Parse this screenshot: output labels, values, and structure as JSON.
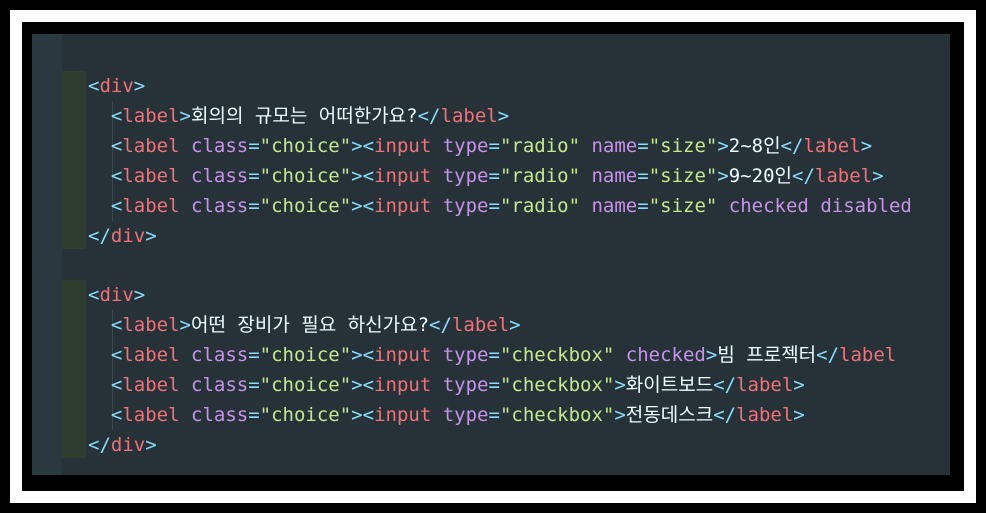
{
  "colors": {
    "background": "#263238",
    "tag": "#f07178",
    "bracket": "#89ddff",
    "attribute": "#c792ea",
    "string": "#c3e88d",
    "text": "#eeffff"
  },
  "lines": [
    {
      "tokens": [
        [
          "brk",
          "<"
        ],
        [
          "tag",
          "div"
        ],
        [
          "brk",
          ">"
        ]
      ]
    },
    {
      "tokens": [
        [
          "txt",
          "  "
        ],
        [
          "brk",
          "<"
        ],
        [
          "tag",
          "label"
        ],
        [
          "brk",
          ">"
        ],
        [
          "txt",
          "회의의 규모는 어떠한가요?"
        ],
        [
          "brk",
          "</"
        ],
        [
          "tag",
          "label"
        ],
        [
          "brk",
          ">"
        ]
      ]
    },
    {
      "tokens": [
        [
          "txt",
          "  "
        ],
        [
          "brk",
          "<"
        ],
        [
          "tag",
          "label"
        ],
        [
          "txt",
          " "
        ],
        [
          "attr",
          "class"
        ],
        [
          "brk",
          "="
        ],
        [
          "str",
          "\"choice\""
        ],
        [
          "brk",
          "><"
        ],
        [
          "tag",
          "input"
        ],
        [
          "txt",
          " "
        ],
        [
          "attr",
          "type"
        ],
        [
          "brk",
          "="
        ],
        [
          "str",
          "\"radio\""
        ],
        [
          "txt",
          " "
        ],
        [
          "attr",
          "name"
        ],
        [
          "brk",
          "="
        ],
        [
          "str",
          "\"size\""
        ],
        [
          "brk",
          ">"
        ],
        [
          "txt",
          "2~8인"
        ],
        [
          "brk",
          "</"
        ],
        [
          "tag",
          "label"
        ],
        [
          "brk",
          ">"
        ]
      ]
    },
    {
      "tokens": [
        [
          "txt",
          "  "
        ],
        [
          "brk",
          "<"
        ],
        [
          "tag",
          "label"
        ],
        [
          "txt",
          " "
        ],
        [
          "attr",
          "class"
        ],
        [
          "brk",
          "="
        ],
        [
          "str",
          "\"choice\""
        ],
        [
          "brk",
          "><"
        ],
        [
          "tag",
          "input"
        ],
        [
          "txt",
          " "
        ],
        [
          "attr",
          "type"
        ],
        [
          "brk",
          "="
        ],
        [
          "str",
          "\"radio\""
        ],
        [
          "txt",
          " "
        ],
        [
          "attr",
          "name"
        ],
        [
          "brk",
          "="
        ],
        [
          "str",
          "\"size\""
        ],
        [
          "brk",
          ">"
        ],
        [
          "txt",
          "9~20인"
        ],
        [
          "brk",
          "</"
        ],
        [
          "tag",
          "label"
        ],
        [
          "brk",
          ">"
        ]
      ]
    },
    {
      "tokens": [
        [
          "txt",
          "  "
        ],
        [
          "brk",
          "<"
        ],
        [
          "tag",
          "label"
        ],
        [
          "txt",
          " "
        ],
        [
          "attr",
          "class"
        ],
        [
          "brk",
          "="
        ],
        [
          "str",
          "\"choice\""
        ],
        [
          "brk",
          "><"
        ],
        [
          "tag",
          "input"
        ],
        [
          "txt",
          " "
        ],
        [
          "attr",
          "type"
        ],
        [
          "brk",
          "="
        ],
        [
          "str",
          "\"radio\""
        ],
        [
          "txt",
          " "
        ],
        [
          "attr",
          "name"
        ],
        [
          "brk",
          "="
        ],
        [
          "str",
          "\"size\""
        ],
        [
          "txt",
          " "
        ],
        [
          "attr",
          "checked"
        ],
        [
          "txt",
          " "
        ],
        [
          "attr",
          "disabled"
        ]
      ]
    },
    {
      "tokens": [
        [
          "brk",
          "</"
        ],
        [
          "tag",
          "div"
        ],
        [
          "brk",
          ">"
        ]
      ]
    },
    {
      "tokens": []
    },
    {
      "tokens": [
        [
          "brk",
          "<"
        ],
        [
          "tag",
          "div"
        ],
        [
          "brk",
          ">"
        ]
      ]
    },
    {
      "tokens": [
        [
          "txt",
          "  "
        ],
        [
          "brk",
          "<"
        ],
        [
          "tag",
          "label"
        ],
        [
          "brk",
          ">"
        ],
        [
          "txt",
          "어떤 장비가 필요 하신가요?"
        ],
        [
          "brk",
          "</"
        ],
        [
          "tag",
          "label"
        ],
        [
          "brk",
          ">"
        ]
      ]
    },
    {
      "tokens": [
        [
          "txt",
          "  "
        ],
        [
          "brk",
          "<"
        ],
        [
          "tag",
          "label"
        ],
        [
          "txt",
          " "
        ],
        [
          "attr",
          "class"
        ],
        [
          "brk",
          "="
        ],
        [
          "str",
          "\"choice\""
        ],
        [
          "brk",
          "><"
        ],
        [
          "tag",
          "input"
        ],
        [
          "txt",
          " "
        ],
        [
          "attr",
          "type"
        ],
        [
          "brk",
          "="
        ],
        [
          "str",
          "\"checkbox\""
        ],
        [
          "txt",
          " "
        ],
        [
          "attr",
          "checked"
        ],
        [
          "brk",
          ">"
        ],
        [
          "txt",
          "빔 프로젝터"
        ],
        [
          "brk",
          "</"
        ],
        [
          "tag",
          "label"
        ]
      ]
    },
    {
      "tokens": [
        [
          "txt",
          "  "
        ],
        [
          "brk",
          "<"
        ],
        [
          "tag",
          "label"
        ],
        [
          "txt",
          " "
        ],
        [
          "attr",
          "class"
        ],
        [
          "brk",
          "="
        ],
        [
          "str",
          "\"choice\""
        ],
        [
          "brk",
          "><"
        ],
        [
          "tag",
          "input"
        ],
        [
          "txt",
          " "
        ],
        [
          "attr",
          "type"
        ],
        [
          "brk",
          "="
        ],
        [
          "str",
          "\"checkbox\""
        ],
        [
          "brk",
          ">"
        ],
        [
          "txt",
          "화이트보드"
        ],
        [
          "brk",
          "</"
        ],
        [
          "tag",
          "label"
        ],
        [
          "brk",
          ">"
        ]
      ]
    },
    {
      "tokens": [
        [
          "txt",
          "  "
        ],
        [
          "brk",
          "<"
        ],
        [
          "tag",
          "label"
        ],
        [
          "txt",
          " "
        ],
        [
          "attr",
          "class"
        ],
        [
          "brk",
          "="
        ],
        [
          "str",
          "\"choice\""
        ],
        [
          "brk",
          "><"
        ],
        [
          "tag",
          "input"
        ],
        [
          "txt",
          " "
        ],
        [
          "attr",
          "type"
        ],
        [
          "brk",
          "="
        ],
        [
          "str",
          "\"checkbox\""
        ],
        [
          "brk",
          ">"
        ],
        [
          "txt",
          "전동데스크"
        ],
        [
          "brk",
          "</"
        ],
        [
          "tag",
          "label"
        ],
        [
          "brk",
          ">"
        ]
      ]
    },
    {
      "tokens": [
        [
          "brk",
          "</"
        ],
        [
          "tag",
          "div"
        ],
        [
          "brk",
          ">"
        ]
      ]
    }
  ]
}
